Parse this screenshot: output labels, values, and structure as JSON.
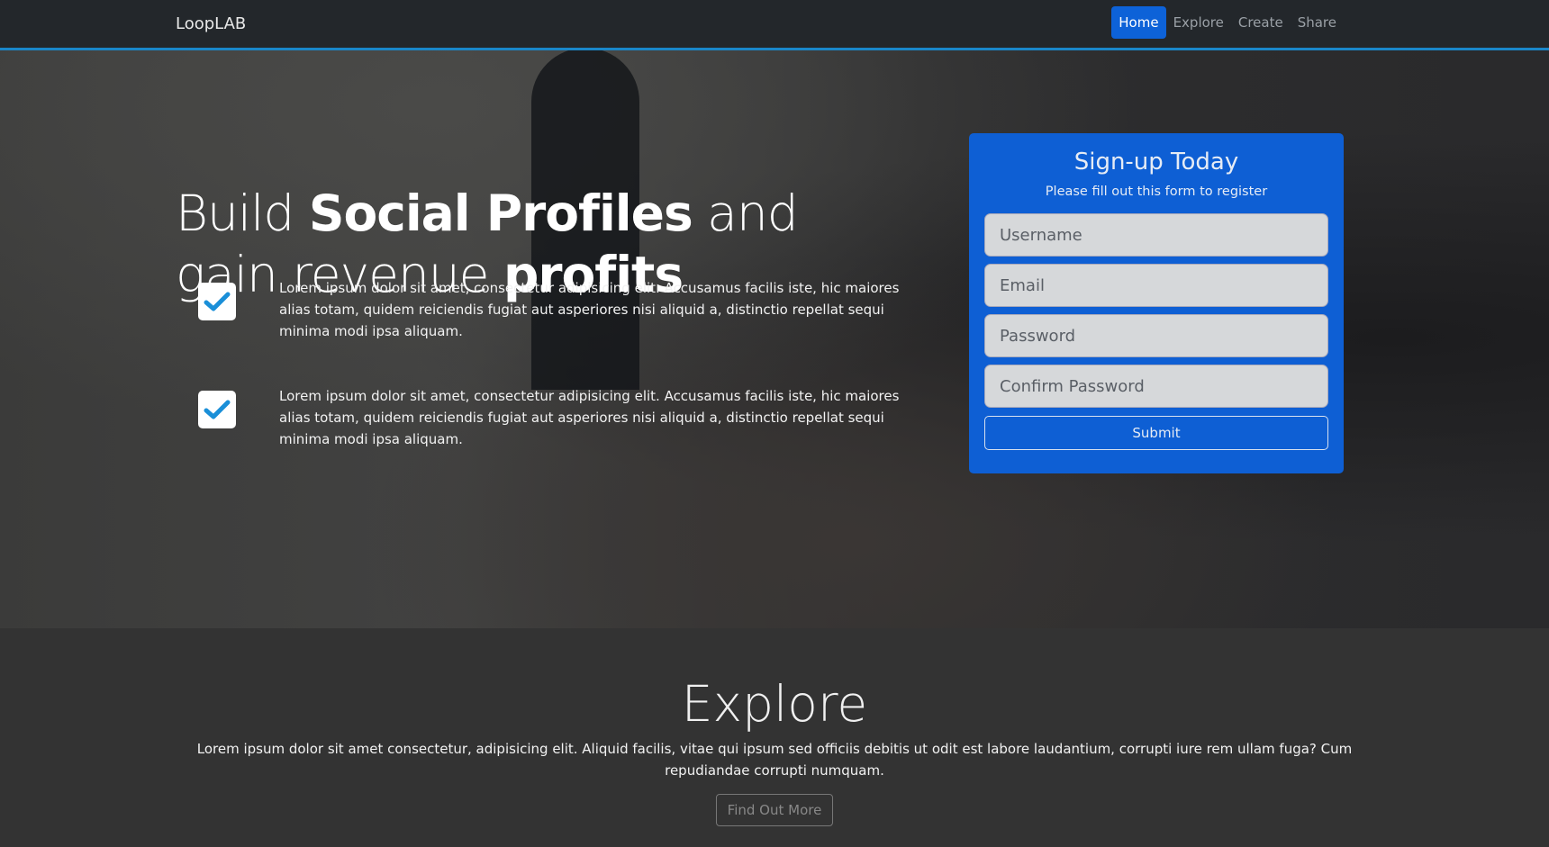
{
  "nav": {
    "brand": "LoopLAB",
    "links": [
      "Home",
      "Explore",
      "Create",
      "Share"
    ],
    "active": "Home"
  },
  "hero": {
    "title_parts": [
      "Build ",
      "Social Profiles",
      " and gain revenue ",
      "profits"
    ],
    "features": [
      {
        "icon": "check-icon",
        "text": "Lorem ipsum dolor sit amet, consectetur adipisicing elit. Accusamus facilis iste, hic maiores alias totam, quidem reiciendis fugiat aut asperiores nisi aliquid a, distinctio repellat sequi minima modi ipsa aliquam."
      },
      {
        "icon": "check-icon",
        "text": "Lorem ipsum dolor sit amet, consectetur adipisicing elit. Accusamus facilis iste, hic maiores alias totam, quidem reiciendis fugiat aut asperiores nisi aliquid a, distinctio repellat sequi minima modi ipsa aliquam."
      }
    ]
  },
  "signup": {
    "title": "Sign-up Today",
    "subtitle": "Please fill out this form to register",
    "placeholders": {
      "username": "Username",
      "email": "Email",
      "password": "Password",
      "confirm": "Confirm Password"
    },
    "submit": "Submit"
  },
  "explore": {
    "title": "Explore",
    "text": "Lorem ipsum dolor sit amet consectetur, adipisicing elit. Aliquid facilis, vitae qui ipsum sed officiis debitis ut odit est labore laudantium, corrupti iure rem ullam fuga? Cum repudiandae corrupti numquam.",
    "button": "Find Out More"
  },
  "colors": {
    "accent": "#0e5fd4",
    "nav_border": "#1a87c9",
    "check": "#1a8fd8"
  }
}
